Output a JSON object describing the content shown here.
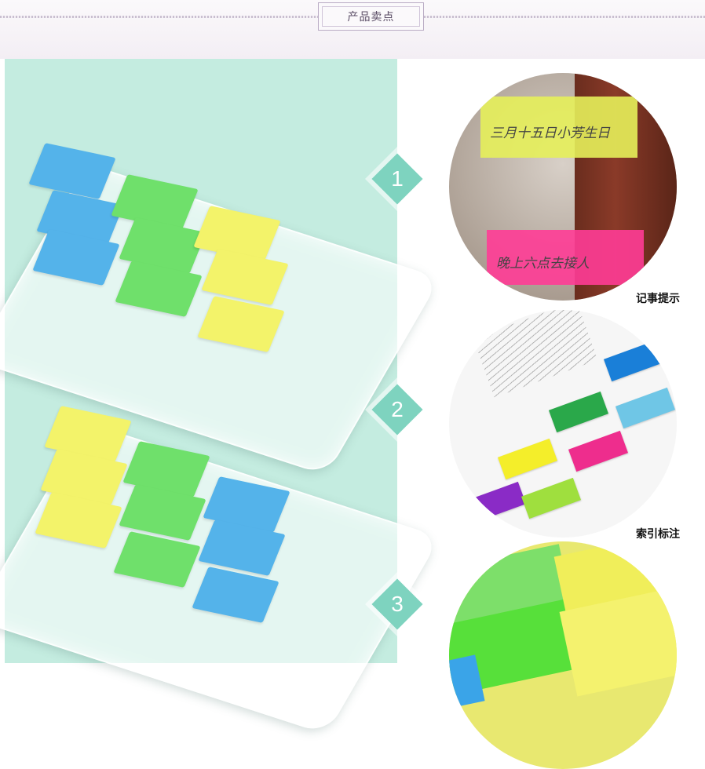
{
  "header": {
    "title": "产品卖点"
  },
  "features": [
    {
      "number": "1",
      "caption": "记事提示"
    },
    {
      "number": "2",
      "caption": "索引标注"
    },
    {
      "number": "3",
      "caption": ""
    }
  ],
  "photos": {
    "circle1": {
      "note_top": "三月十五日小芳生日",
      "note_bottom": "晚上六点去接人"
    }
  },
  "colors": {
    "panel_bg": "#c4ece0",
    "badge": "#7ed3bf",
    "blue": "#54b3ea",
    "green": "#6fe06b",
    "yellow": "#f3f36a",
    "pink": "#ff3c96"
  }
}
